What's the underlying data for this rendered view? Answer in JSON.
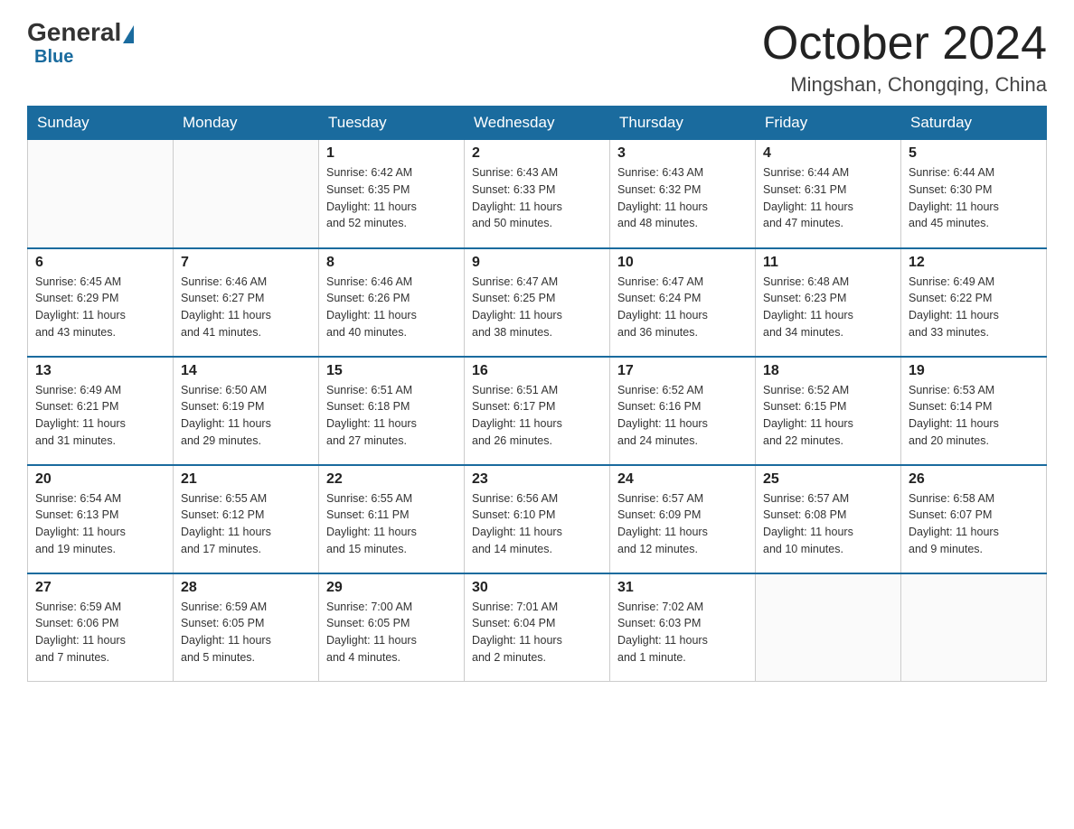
{
  "logo": {
    "general": "General",
    "blue": "Blue"
  },
  "title": "October 2024",
  "subtitle": "Mingshan, Chongqing, China",
  "days_of_week": [
    "Sunday",
    "Monday",
    "Tuesday",
    "Wednesday",
    "Thursday",
    "Friday",
    "Saturday"
  ],
  "weeks": [
    [
      {
        "day": "",
        "info": ""
      },
      {
        "day": "",
        "info": ""
      },
      {
        "day": "1",
        "info": "Sunrise: 6:42 AM\nSunset: 6:35 PM\nDaylight: 11 hours\nand 52 minutes."
      },
      {
        "day": "2",
        "info": "Sunrise: 6:43 AM\nSunset: 6:33 PM\nDaylight: 11 hours\nand 50 minutes."
      },
      {
        "day": "3",
        "info": "Sunrise: 6:43 AM\nSunset: 6:32 PM\nDaylight: 11 hours\nand 48 minutes."
      },
      {
        "day": "4",
        "info": "Sunrise: 6:44 AM\nSunset: 6:31 PM\nDaylight: 11 hours\nand 47 minutes."
      },
      {
        "day": "5",
        "info": "Sunrise: 6:44 AM\nSunset: 6:30 PM\nDaylight: 11 hours\nand 45 minutes."
      }
    ],
    [
      {
        "day": "6",
        "info": "Sunrise: 6:45 AM\nSunset: 6:29 PM\nDaylight: 11 hours\nand 43 minutes."
      },
      {
        "day": "7",
        "info": "Sunrise: 6:46 AM\nSunset: 6:27 PM\nDaylight: 11 hours\nand 41 minutes."
      },
      {
        "day": "8",
        "info": "Sunrise: 6:46 AM\nSunset: 6:26 PM\nDaylight: 11 hours\nand 40 minutes."
      },
      {
        "day": "9",
        "info": "Sunrise: 6:47 AM\nSunset: 6:25 PM\nDaylight: 11 hours\nand 38 minutes."
      },
      {
        "day": "10",
        "info": "Sunrise: 6:47 AM\nSunset: 6:24 PM\nDaylight: 11 hours\nand 36 minutes."
      },
      {
        "day": "11",
        "info": "Sunrise: 6:48 AM\nSunset: 6:23 PM\nDaylight: 11 hours\nand 34 minutes."
      },
      {
        "day": "12",
        "info": "Sunrise: 6:49 AM\nSunset: 6:22 PM\nDaylight: 11 hours\nand 33 minutes."
      }
    ],
    [
      {
        "day": "13",
        "info": "Sunrise: 6:49 AM\nSunset: 6:21 PM\nDaylight: 11 hours\nand 31 minutes."
      },
      {
        "day": "14",
        "info": "Sunrise: 6:50 AM\nSunset: 6:19 PM\nDaylight: 11 hours\nand 29 minutes."
      },
      {
        "day": "15",
        "info": "Sunrise: 6:51 AM\nSunset: 6:18 PM\nDaylight: 11 hours\nand 27 minutes."
      },
      {
        "day": "16",
        "info": "Sunrise: 6:51 AM\nSunset: 6:17 PM\nDaylight: 11 hours\nand 26 minutes."
      },
      {
        "day": "17",
        "info": "Sunrise: 6:52 AM\nSunset: 6:16 PM\nDaylight: 11 hours\nand 24 minutes."
      },
      {
        "day": "18",
        "info": "Sunrise: 6:52 AM\nSunset: 6:15 PM\nDaylight: 11 hours\nand 22 minutes."
      },
      {
        "day": "19",
        "info": "Sunrise: 6:53 AM\nSunset: 6:14 PM\nDaylight: 11 hours\nand 20 minutes."
      }
    ],
    [
      {
        "day": "20",
        "info": "Sunrise: 6:54 AM\nSunset: 6:13 PM\nDaylight: 11 hours\nand 19 minutes."
      },
      {
        "day": "21",
        "info": "Sunrise: 6:55 AM\nSunset: 6:12 PM\nDaylight: 11 hours\nand 17 minutes."
      },
      {
        "day": "22",
        "info": "Sunrise: 6:55 AM\nSunset: 6:11 PM\nDaylight: 11 hours\nand 15 minutes."
      },
      {
        "day": "23",
        "info": "Sunrise: 6:56 AM\nSunset: 6:10 PM\nDaylight: 11 hours\nand 14 minutes."
      },
      {
        "day": "24",
        "info": "Sunrise: 6:57 AM\nSunset: 6:09 PM\nDaylight: 11 hours\nand 12 minutes."
      },
      {
        "day": "25",
        "info": "Sunrise: 6:57 AM\nSunset: 6:08 PM\nDaylight: 11 hours\nand 10 minutes."
      },
      {
        "day": "26",
        "info": "Sunrise: 6:58 AM\nSunset: 6:07 PM\nDaylight: 11 hours\nand 9 minutes."
      }
    ],
    [
      {
        "day": "27",
        "info": "Sunrise: 6:59 AM\nSunset: 6:06 PM\nDaylight: 11 hours\nand 7 minutes."
      },
      {
        "day": "28",
        "info": "Sunrise: 6:59 AM\nSunset: 6:05 PM\nDaylight: 11 hours\nand 5 minutes."
      },
      {
        "day": "29",
        "info": "Sunrise: 7:00 AM\nSunset: 6:05 PM\nDaylight: 11 hours\nand 4 minutes."
      },
      {
        "day": "30",
        "info": "Sunrise: 7:01 AM\nSunset: 6:04 PM\nDaylight: 11 hours\nand 2 minutes."
      },
      {
        "day": "31",
        "info": "Sunrise: 7:02 AM\nSunset: 6:03 PM\nDaylight: 11 hours\nand 1 minute."
      },
      {
        "day": "",
        "info": ""
      },
      {
        "day": "",
        "info": ""
      }
    ]
  ]
}
